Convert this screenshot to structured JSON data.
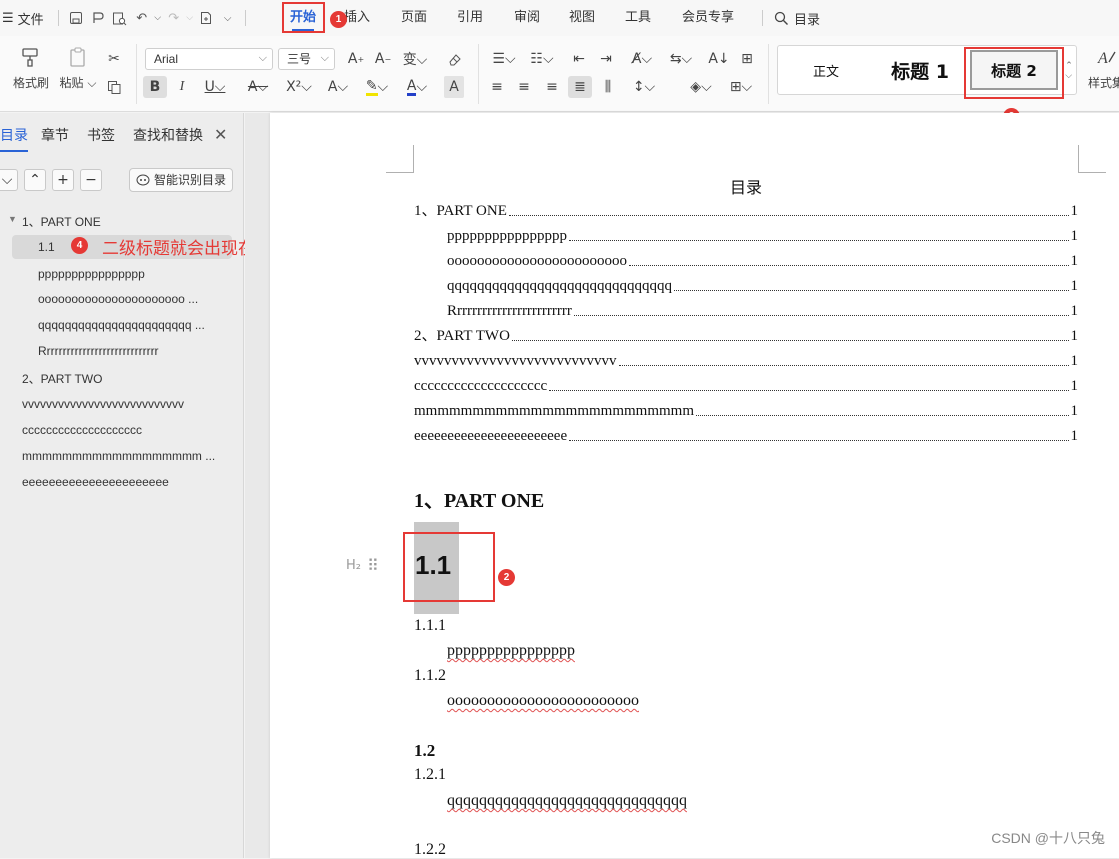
{
  "menubar": {
    "file_label": "文件",
    "tabs": [
      {
        "label": "开始",
        "active": true
      },
      {
        "label": "插入"
      },
      {
        "label": "页面"
      },
      {
        "label": "引用"
      },
      {
        "label": "审阅"
      },
      {
        "label": "视图"
      },
      {
        "label": "工具"
      },
      {
        "label": "会员专享"
      }
    ],
    "search_label": "目录"
  },
  "ribbon": {
    "format_painter": "格式刷",
    "paste": "粘贴",
    "font_name": "Arial",
    "font_size": "三号",
    "styles": [
      "正文",
      "标题 1",
      "标题 2"
    ],
    "style_gallery_label": "样式集"
  },
  "nav": {
    "tabs": [
      "目录",
      "章节",
      "书签",
      "查找和替换"
    ],
    "smart_button": "智能识别目录",
    "toc": [
      {
        "label": "1、PART ONE",
        "level": 1,
        "expanded": true
      },
      {
        "label": "1.1",
        "level": 2,
        "selected": true
      },
      {
        "label": "pppppppppppppppp",
        "level": 3
      },
      {
        "label": "oooooooooooooooooooooo ...",
        "level": 3
      },
      {
        "label": "qqqqqqqqqqqqqqqqqqqqqqq ...",
        "level": 3
      },
      {
        "label": "Rrrrrrrrrrrrrrrrrrrrrrrrrrrrr",
        "level": 3
      },
      {
        "label": "2、PART TWO",
        "level": 1
      },
      {
        "label": "vvvvvvvvvvvvvvvvvvvvvvvvvvv",
        "level": 2
      },
      {
        "label": "cccccccccccccccccccc",
        "level": 2
      },
      {
        "label": "mmmmmmmmmmmmmmmmmm ...",
        "level": 2
      },
      {
        "label": "eeeeeeeeeeeeeeeeeeeeee",
        "level": 2
      }
    ]
  },
  "annotations": {
    "badges": [
      "1",
      "2",
      "3",
      "4"
    ],
    "note": "二级标题就会出现在目录中"
  },
  "document": {
    "toc_title": "目录",
    "toc_rows": [
      {
        "text": "1、PART ONE",
        "page": "1",
        "indent": 0
      },
      {
        "text": "pppppppppppppppp",
        "page": "1",
        "indent": 1
      },
      {
        "text": "oooooooooooooooooooooooo",
        "page": "1",
        "indent": 1
      },
      {
        "text": "qqqqqqqqqqqqqqqqqqqqqqqqqqqqqq",
        "page": "1",
        "indent": 1
      },
      {
        "text": "Rrrrrrrrrrrrrrrrrrrrrrrr",
        "page": "1",
        "indent": 1
      },
      {
        "text": "2、PART TWO",
        "page": "1",
        "indent": 0
      },
      {
        "text": "vvvvvvvvvvvvvvvvvvvvvvvvvvv",
        "page": "1",
        "indent": 0
      },
      {
        "text": "cccccccccccccccccccc",
        "page": "1",
        "indent": 0
      },
      {
        "text": "mmmmmmmmmmmmmmmmmmmmmmmm",
        "page": "1",
        "indent": 0
      },
      {
        "text": "eeeeeeeeeeeeeeeeeeeeeee",
        "page": "1",
        "indent": 0
      }
    ],
    "heading1": "1、PART ONE",
    "heading2_marker": "H₂",
    "heading2": "1.1",
    "h3_a": "1.1.1",
    "body_a": "pppppppppppppppp",
    "h3_b": "1.1.2",
    "body_b": "oooooooooooooooooooooooo",
    "heading2_b": "1.2",
    "h3_c": "1.2.1",
    "body_c": "qqqqqqqqqqqqqqqqqqqqqqqqqqqqqq",
    "h3_d": "1.2.2"
  },
  "watermark": "CSDN @十八只兔",
  "colors": {
    "accent": "#2a63d6",
    "annotation_red": "#e53935",
    "heading_highlight": "#c8c8c8"
  }
}
